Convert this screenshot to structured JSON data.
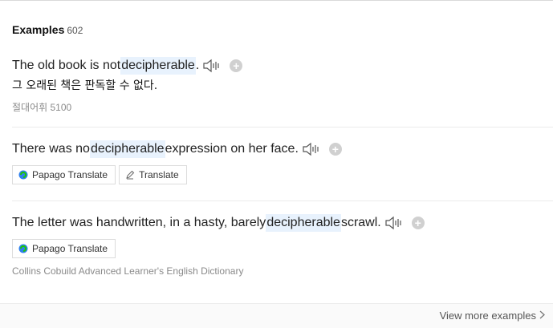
{
  "header": {
    "title": "Examples",
    "count": "602"
  },
  "examples": [
    {
      "before": "The old book is not ",
      "highlight": "decipherable",
      "after": ".",
      "translation": "그 오래된 책은 판독할 수 없다.",
      "source": "절대어휘 5100"
    },
    {
      "before": "There was no ",
      "highlight": "decipherable",
      "after": " expression on her face.",
      "buttons": [
        "Papago Translate",
        "Translate"
      ]
    },
    {
      "before": "The letter was handwritten, in a hasty, barely ",
      "highlight": "decipherable",
      "after": " scrawl.",
      "buttons": [
        "Papago Translate"
      ],
      "source": "Collins Cobuild Advanced Learner's English Dictionary"
    }
  ],
  "footer": {
    "view_more": "View more examples"
  },
  "icons": {
    "speaker": "speaker-icon",
    "add": "add-icon",
    "papago": "papago-icon",
    "pen": "pen-icon",
    "chevron": "chevron-right-icon"
  },
  "colors": {
    "highlight": "#e8f2fd",
    "papago_green": "#1ec800",
    "papago_blue": "#2f80ed"
  }
}
